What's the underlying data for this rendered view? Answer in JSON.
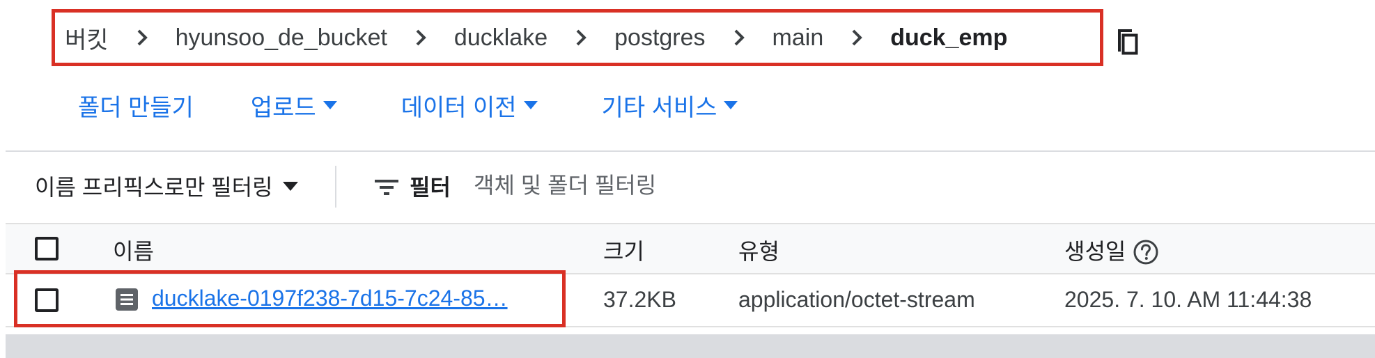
{
  "breadcrumb": {
    "items": [
      "버킷",
      "hyunsoo_de_bucket",
      "ducklake",
      "postgres",
      "main",
      "duck_emp"
    ],
    "copy_icon": "copy-icon",
    "separator_icon": "chevron-right-icon"
  },
  "toolbar": {
    "create_folder": "폴더 만들기",
    "upload": "업로드",
    "transfer_data": "데이터 이전",
    "other_services": "기타 서비스"
  },
  "filter": {
    "prefix_dropdown": "이름 프리픽스로만 필터링",
    "filter_label": "필터",
    "placeholder": "객체 및 폴더 필터링",
    "value": ""
  },
  "table": {
    "columns": {
      "name": "이름",
      "size": "크기",
      "type": "유형",
      "created": "생성일"
    },
    "rows": [
      {
        "name": "ducklake-0197f238-7d15-7c24-85…",
        "size": "37.2KB",
        "type": "application/octet-stream",
        "created": "2025. 7. 10. AM 11:44:38"
      }
    ]
  },
  "colors": {
    "accent": "#1a73e8",
    "highlight": "#d93025",
    "text": "#3c4043"
  }
}
